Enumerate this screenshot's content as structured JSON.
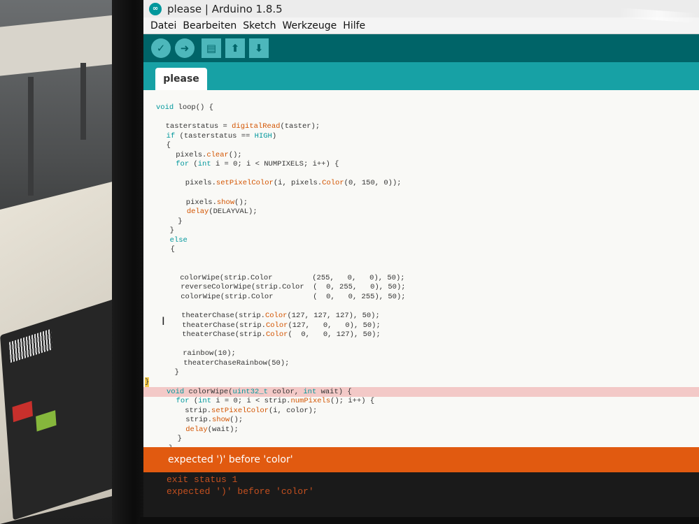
{
  "window": {
    "title": "please | Arduino 1.8.5",
    "logo_icon": "arduino-infinity-icon"
  },
  "menu": [
    "Datei",
    "Bearbeiten",
    "Sketch",
    "Werkzeuge",
    "Hilfe"
  ],
  "toolbar": {
    "buttons": [
      {
        "name": "verify",
        "icon": "check-icon",
        "glyph": "✓"
      },
      {
        "name": "upload",
        "icon": "arrow-right-icon",
        "glyph": "➜"
      },
      {
        "name": "new",
        "icon": "document-icon",
        "glyph": "▤"
      },
      {
        "name": "open",
        "icon": "arrow-up-icon",
        "glyph": "⬆"
      },
      {
        "name": "save",
        "icon": "arrow-down-icon",
        "glyph": "⬇"
      }
    ]
  },
  "tabs": [
    {
      "label": "please"
    }
  ],
  "code": [
    "void loop() {",
    "",
    "  tasterstatus = digitalRead(taster);",
    "  if (tasterstatus == HIGH)",
    "  {",
    "    pixels.clear();",
    "    for (int i = 0; i < NUMPIXELS; i++) {",
    "",
    "      pixels.setPixelColor(i, pixels.Color(0, 150, 0));",
    "",
    "      pixels.show();",
    "      delay(DELAYVAL);",
    "    }",
    "  }",
    "  else",
    "  {",
    "",
    "",
    "    colorWipe(strip.Color         (255,   0,   0), 50);",
    "    reverseColorWipe(strip.Color  (  0, 255,   0), 50);",
    "    colorWipe(strip.Color         (  0,   0, 255), 50);",
    "",
    "    theaterChase(strip.Color(127, 127, 127), 50);",
    "    theaterChase(strip.Color(127,   0,   0), 50);",
    "    theaterChase(strip.Color(  0,   0, 127), 50);",
    "",
    "    rainbow(10);",
    "    theaterChaseRainbow(50);",
    "  }",
    "}",
    "void colorWipe(uint32_t color, int wait) {",
    "  for (int i = 0; i < strip.numPixels(); i++) {",
    "    strip.setPixelColor(i, color);",
    "    strip.show();",
    "    delay(wait);",
    "  }",
    "}"
  ],
  "error_line_index": 30,
  "status": {
    "message": "expected ')' before 'color'",
    "color": "#e15a10"
  },
  "console": [
    "exit status 1",
    "expected ')' before 'color'"
  ],
  "colors": {
    "toolbar": "#006468",
    "tabbar": "#17a1a5",
    "keyword": "#00979c",
    "function": "#d35400"
  }
}
